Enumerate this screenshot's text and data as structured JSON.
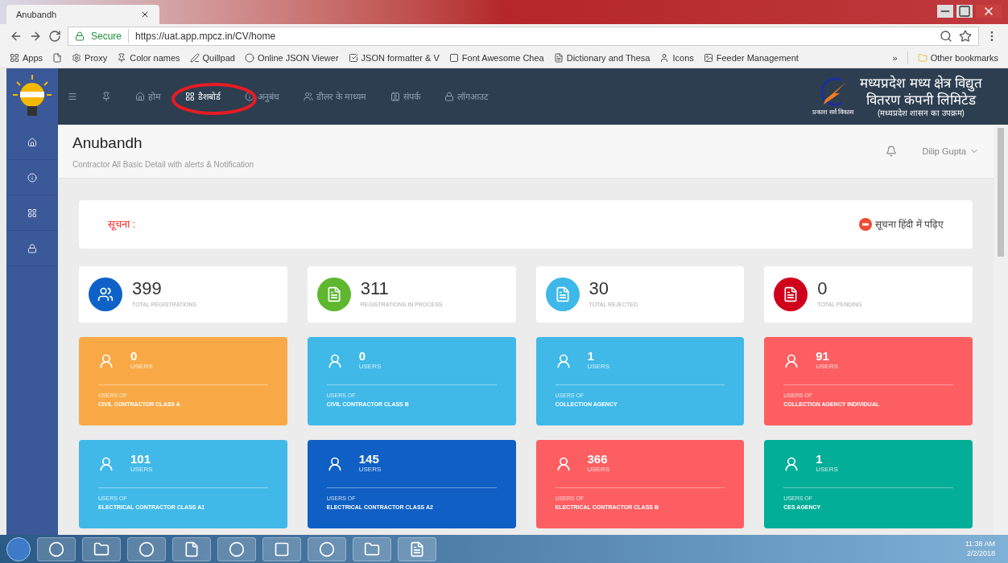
{
  "browser": {
    "tab_title": "Anubandh",
    "address_secure": "Secure",
    "address_url": "https://uat.app.mpcz.in/CV/home",
    "bookmarks": [
      {
        "label": "Apps",
        "kind": "apps"
      },
      {
        "kind": "page"
      },
      {
        "label": "Proxy",
        "kind": "gear"
      },
      {
        "label": "Color names",
        "kind": "pin"
      },
      {
        "label": "Quillpad",
        "kind": "pen"
      },
      {
        "label": "Online JSON Viewer",
        "kind": "ring"
      },
      {
        "label": "JSON formatter & V",
        "kind": "check"
      },
      {
        "label": "Font Awesome Chea",
        "kind": "square"
      },
      {
        "label": "Dictionary and Thesa",
        "kind": "letter"
      },
      {
        "label": "Icons",
        "kind": "person"
      },
      {
        "label": "Feeder Management",
        "kind": "image"
      }
    ],
    "overflow": "»",
    "other_bookmarks": "Other bookmarks"
  },
  "nav": [
    {
      "kind": "menu",
      "selected": false
    },
    {
      "kind": "pin",
      "selected": false
    },
    {
      "label": "होम",
      "kind": "home",
      "selected": false
    },
    {
      "label": "डैशबोर्ड",
      "kind": "grid",
      "selected": true
    },
    {
      "label": "अनुबंध",
      "kind": "info",
      "selected": false
    },
    {
      "label": "डीलर के माध्यम",
      "kind": "users",
      "selected": false
    },
    {
      "label": "संपर्क",
      "kind": "contact",
      "selected": false
    },
    {
      "label": "लॉगआउट",
      "kind": "lock",
      "selected": false
    }
  ],
  "brand": {
    "line_1": "मध्यप्रदेश मध्य क्षेत्र विद्युत",
    "line_2": "वितरण कंपनी लिमिटेड",
    "line_3": "(मध्यप्रदेश शासन का उपक्रम)",
    "tagline": "प्रकाश सर्व विकास"
  },
  "sidebar": [
    {
      "kind": "home"
    },
    {
      "kind": "info"
    },
    {
      "kind": "grid"
    },
    {
      "kind": "lock"
    }
  ],
  "page": {
    "title": "Anubandh",
    "subtitle": "Contractor All Basic Detail with alerts & Notification",
    "user": "Dilip Gupta"
  },
  "notice": {
    "label": "सूचना :",
    "link": "सूचना हिंदी में पढ़िए"
  },
  "stats": [
    {
      "value": "399",
      "label": "TOTAL REGISTRATIONS",
      "color": "#0e62c7",
      "kind": "users"
    },
    {
      "value": "311",
      "label": "REGISTRATIONS IN PROCESS",
      "color": "#5eb72e",
      "kind": "doc"
    },
    {
      "value": "30",
      "label": "TOTAL REJECTED",
      "color": "#3db8e8",
      "kind": "doc"
    },
    {
      "value": "0",
      "label": "TOTAL PENDING",
      "color": "#d0021b",
      "kind": "doc"
    }
  ],
  "cards": [
    {
      "count": "0",
      "unit": "USERS",
      "caption_1": "USERS OF",
      "caption_2": "CIVIL CONTRACTOR CLASS A",
      "color": "#f8a946"
    },
    {
      "count": "0",
      "unit": "USERS",
      "caption_1": "USERS OF",
      "caption_2": "CIVIL CONTRACTOR CLASS B",
      "color": "#40b9e8"
    },
    {
      "count": "1",
      "unit": "USERS",
      "caption_1": "USERS OF",
      "caption_2": "COLLECTION AGENCY",
      "color": "#40b9e8"
    },
    {
      "count": "91",
      "unit": "USERS",
      "caption_1": "USERS OF",
      "caption_2": "COLLECTION AGENCY INDIVIDUAL",
      "color": "#fd5e61"
    },
    {
      "count": "101",
      "unit": "USERS",
      "caption_1": "USERS OF",
      "caption_2": "ELECTRICAL CONTRACTOR CLASS A1",
      "color": "#40b9e8"
    },
    {
      "count": "145",
      "unit": "USERS",
      "caption_1": "USERS OF",
      "caption_2": "ELECTRICAL CONTRACTOR CLASS A2",
      "color": "#0f5fc4"
    },
    {
      "count": "366",
      "unit": "USERS",
      "caption_1": "USERS OF",
      "caption_2": "ELECTRICAL CONTRACTOR CLASS B",
      "color": "#fd5e61"
    },
    {
      "count": "1",
      "unit": "USERS",
      "caption_1": "USERS OF",
      "caption_2": "CES AGENCY",
      "color": "#02ae98"
    }
  ],
  "taskbar": {
    "time": "11:38 AM",
    "date": "2/2/2018"
  }
}
